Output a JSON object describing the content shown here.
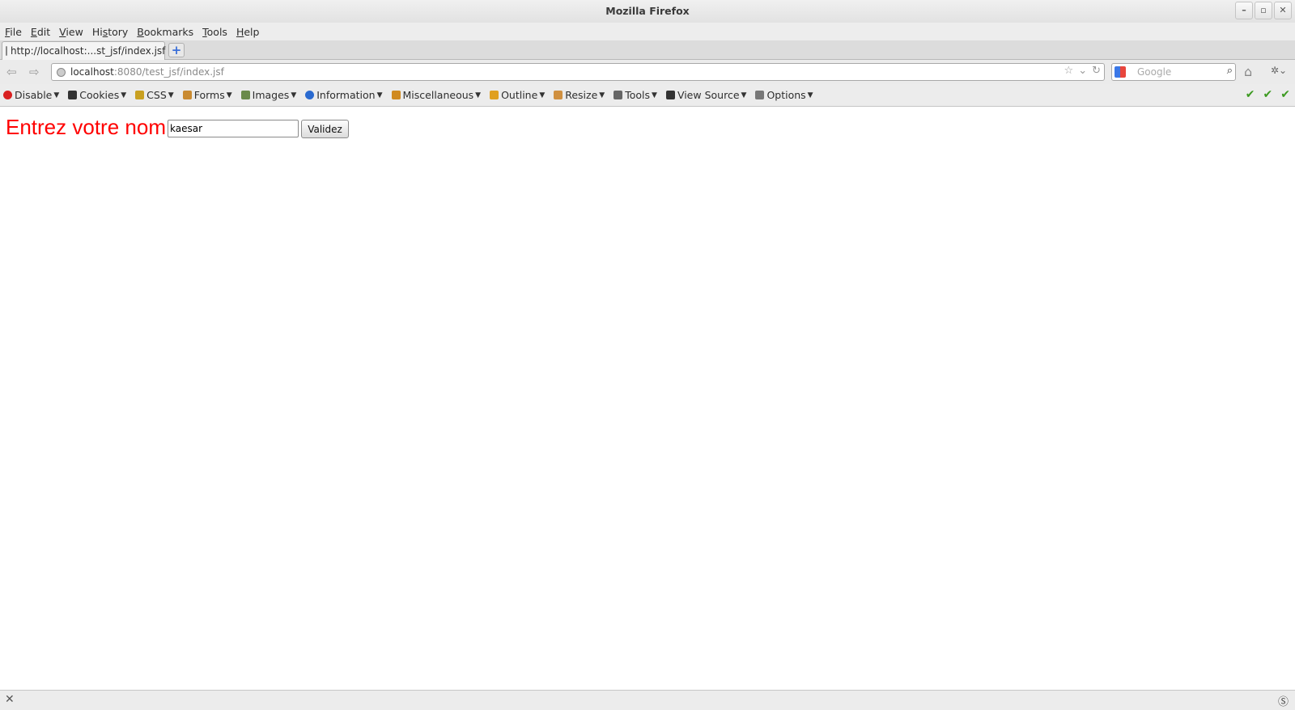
{
  "window": {
    "title": "Mozilla Firefox",
    "controls": [
      "–",
      "▫",
      "✕"
    ]
  },
  "menubar": {
    "items": [
      {
        "label": "File",
        "accel": "F",
        "rest": "ile"
      },
      {
        "label": "Edit",
        "accel": "E",
        "rest": "dit"
      },
      {
        "label": "View",
        "accel": "V",
        "rest": "iew"
      },
      {
        "label": "History",
        "pre": "Hi",
        "accel": "s",
        "rest": "tory"
      },
      {
        "label": "Bookmarks",
        "accel": "B",
        "rest": "ookmarks"
      },
      {
        "label": "Tools",
        "accel": "T",
        "rest": "ools"
      },
      {
        "label": "Help",
        "accel": "H",
        "rest": "elp"
      }
    ]
  },
  "tabs": {
    "active_label": "http://localhost:...st_jsf/index.jsf",
    "new_tab": "+"
  },
  "navbar": {
    "url_host": "localhost",
    "url_rest": ":8080/test_jsf/index.jsf",
    "search_placeholder": "Google"
  },
  "webdev_toolbar": {
    "items": [
      {
        "label": "Disable",
        "icon": "disable-icon",
        "color": "#d92020"
      },
      {
        "label": "Cookies",
        "icon": "cookies-icon",
        "color": "#333333"
      },
      {
        "label": "CSS",
        "icon": "css-icon",
        "color": "#c9a020"
      },
      {
        "label": "Forms",
        "icon": "forms-icon",
        "color": "#c98a30"
      },
      {
        "label": "Images",
        "icon": "images-icon",
        "color": "#6a8a4a"
      },
      {
        "label": "Information",
        "icon": "information-icon",
        "color": "#2a6ad0"
      },
      {
        "label": "Miscellaneous",
        "icon": "miscellaneous-icon",
        "color": "#d08a20"
      },
      {
        "label": "Outline",
        "icon": "outline-icon",
        "color": "#e0a020"
      },
      {
        "label": "Resize",
        "icon": "resize-icon",
        "color": "#d09040"
      },
      {
        "label": "Tools",
        "icon": "tools-icon",
        "color": "#666666"
      },
      {
        "label": "View Source",
        "icon": "view-source-icon",
        "color": "#333333"
      },
      {
        "label": "Options",
        "icon": "options-icon",
        "color": "#777777"
      }
    ],
    "checks": [
      "✔",
      "✔",
      "✔"
    ]
  },
  "page": {
    "label": "Entrez votre nom",
    "input_value": "kaesar",
    "submit_label": "Validez",
    "label_color": "#ff0000"
  }
}
